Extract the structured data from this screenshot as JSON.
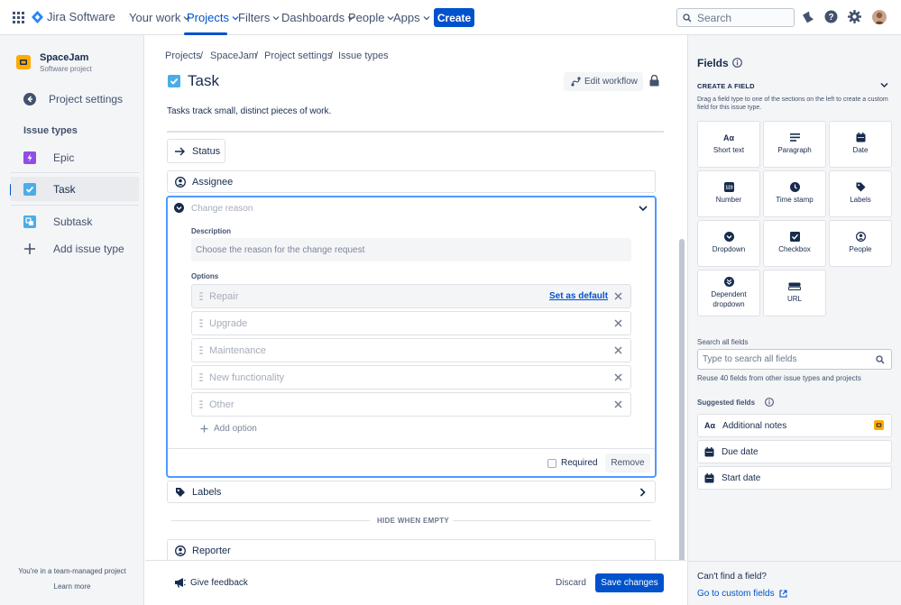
{
  "nav": {
    "app_name": "Jira Software",
    "items": [
      {
        "label": "Your work",
        "active": false
      },
      {
        "label": "Projects",
        "active": true
      },
      {
        "label": "Filters",
        "active": false
      },
      {
        "label": "Dashboards",
        "active": false
      },
      {
        "label": "People",
        "active": false
      },
      {
        "label": "Apps",
        "active": false
      }
    ],
    "create_label": "Create",
    "search_placeholder": "Search"
  },
  "sidebar": {
    "project_name": "SpaceJam",
    "project_type": "Software project",
    "settings_label": "Project settings",
    "section_title": "Issue types",
    "items": [
      {
        "label": "Epic"
      },
      {
        "label": "Task",
        "selected": true
      },
      {
        "label": "Subtask"
      }
    ],
    "add_label": "Add issue type",
    "footer_text": "You're in a team-managed project",
    "learn_more": "Learn more"
  },
  "breadcrumb": [
    "Projects",
    "SpaceJam",
    "Project settings",
    "Issue types"
  ],
  "issue": {
    "title": "Task",
    "description": "Tasks track small, distinct pieces of work.",
    "edit_workflow": "Edit workflow"
  },
  "fields": {
    "status": "Status",
    "assignee": "Assignee",
    "change_reason": {
      "name_placeholder": "Change reason",
      "description_label": "Description",
      "description_placeholder": "Choose the reason for the change request",
      "options_label": "Options",
      "options": [
        "Repair",
        "Upgrade",
        "Maintenance",
        "New functionality",
        "Other"
      ],
      "set_default": "Set as default",
      "add_option": "Add option",
      "required_label": "Required",
      "remove_label": "Remove"
    },
    "labels": "Labels",
    "hide_when_empty": "HIDE WHEN EMPTY",
    "reporter": "Reporter"
  },
  "footer": {
    "feedback": "Give feedback",
    "discard": "Discard",
    "save": "Save changes"
  },
  "right_panel": {
    "title": "Fields",
    "create_heading": "CREATE A FIELD",
    "create_help": "Drag a field type to one of the sections on the left to create a custom field for this issue type.",
    "tiles": [
      {
        "label": "Short text",
        "icon": "short-text-icon"
      },
      {
        "label": "Paragraph",
        "icon": "paragraph-icon"
      },
      {
        "label": "Date",
        "icon": "calendar-icon"
      },
      {
        "label": "Number",
        "icon": "number-icon"
      },
      {
        "label": "Time stamp",
        "icon": "clock-icon"
      },
      {
        "label": "Labels",
        "icon": "label-tag-icon"
      },
      {
        "label": "Dropdown",
        "icon": "dropdown-icon"
      },
      {
        "label": "Checkbox",
        "icon": "checkbox-icon"
      },
      {
        "label": "People",
        "icon": "person-icon"
      },
      {
        "label": "Dependent dropdown",
        "icon": "dependent-dropdown-icon"
      },
      {
        "label": "URL",
        "icon": "url-icon"
      }
    ],
    "search_label": "Search all fields",
    "search_placeholder": "Type to search all fields",
    "reuse_text": "Reuse 40 fields from other issue types and projects",
    "suggested_label": "Suggested fields",
    "suggested": [
      "Additional notes",
      "Due date",
      "Start date"
    ],
    "cant_find": "Can't find a field?",
    "custom_link": "Go to custom fields"
  },
  "colors": {
    "brand_blue": "#0052cc",
    "task_blue": "#4bade8",
    "epic_purple": "#904ee2",
    "text_dark": "#172b4d"
  }
}
